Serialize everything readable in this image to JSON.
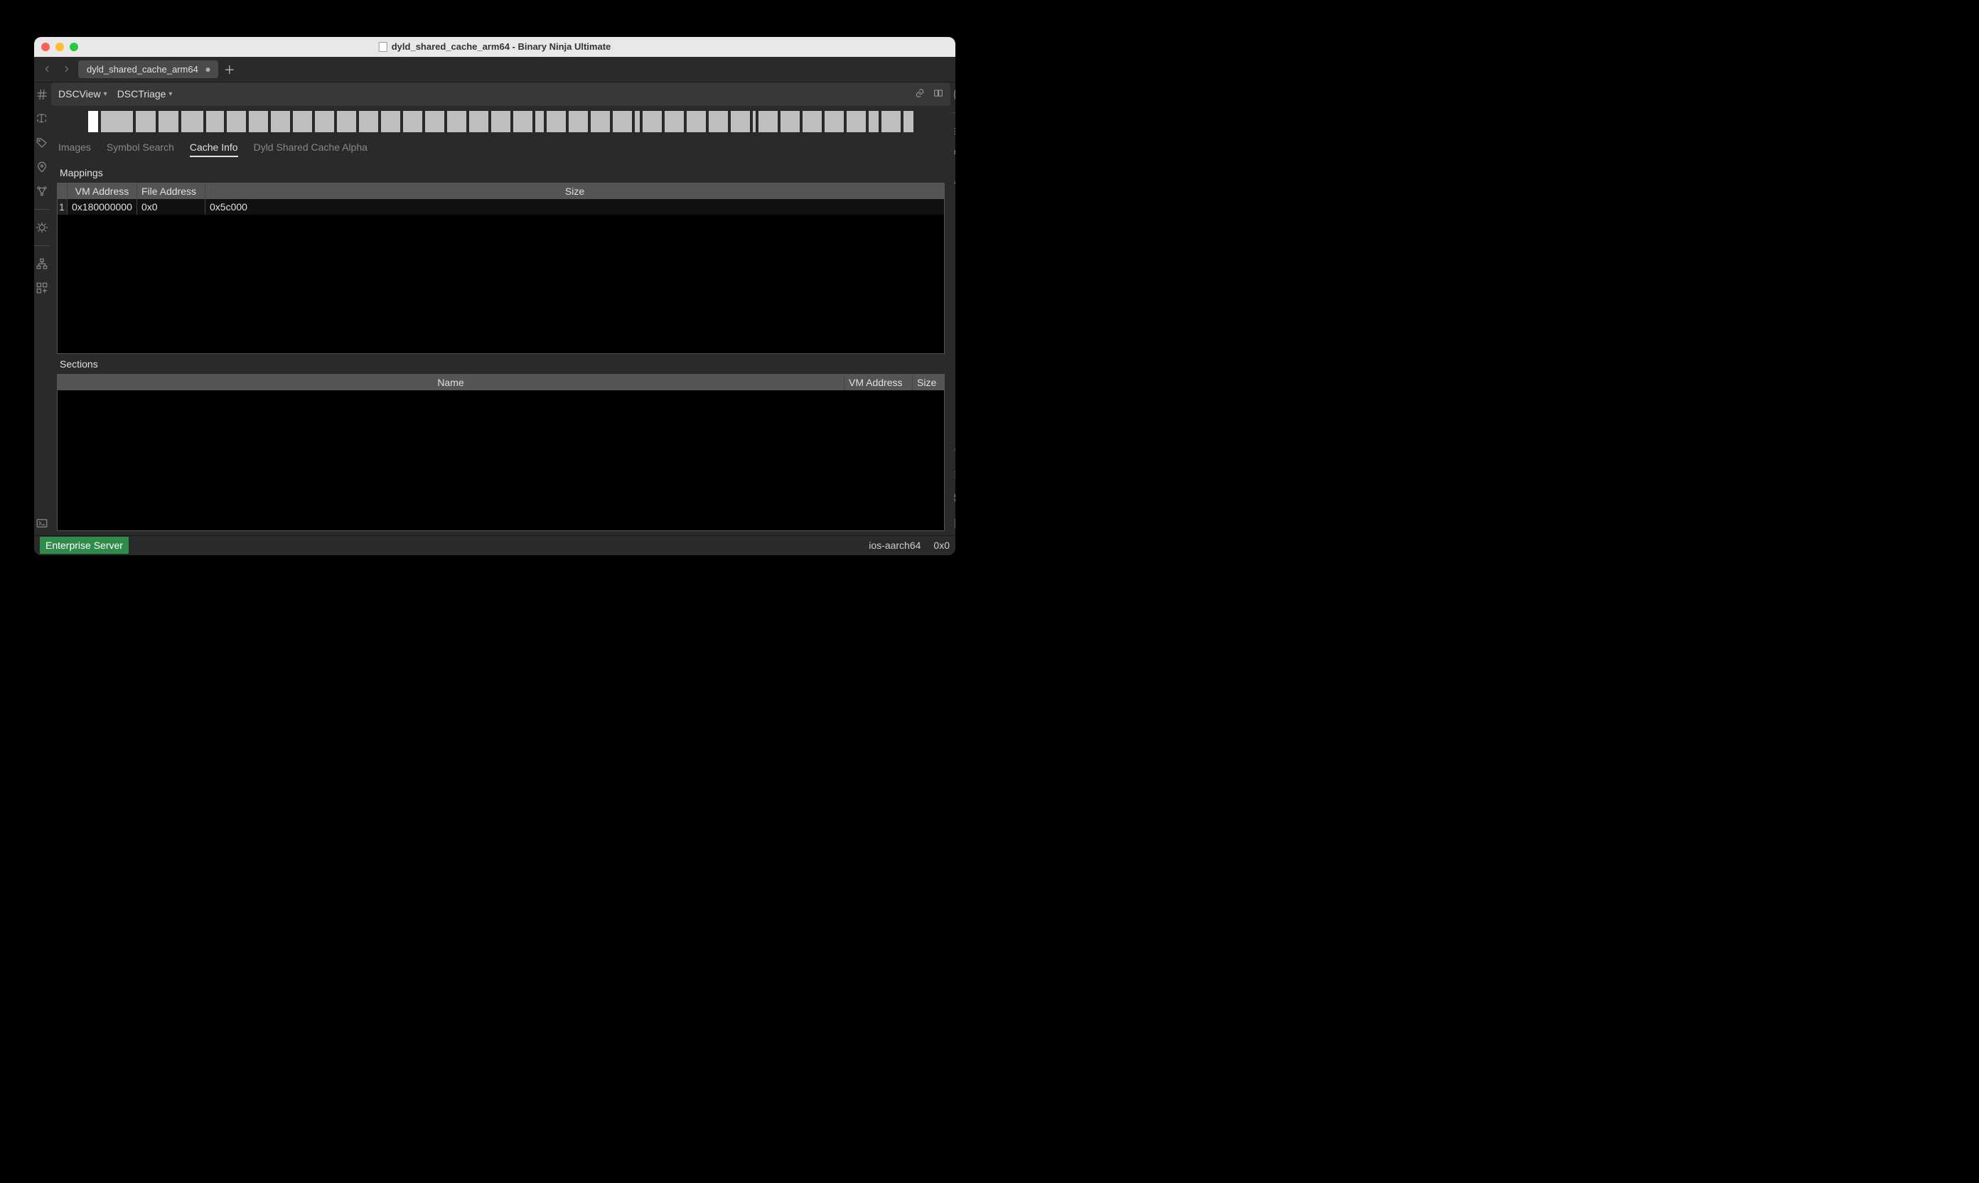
{
  "window": {
    "title": "dyld_shared_cache_arm64 - Binary Ninja Ultimate"
  },
  "tabs": {
    "items": [
      {
        "label": "dyld_shared_cache_arm64"
      }
    ]
  },
  "view_header": {
    "dropdowns": [
      {
        "label": "DSCView"
      },
      {
        "label": "DSCTriage"
      }
    ]
  },
  "section_tabs": [
    {
      "label": "Images",
      "active": false
    },
    {
      "label": "Symbol Search",
      "active": false
    },
    {
      "label": "Cache Info",
      "active": true
    },
    {
      "label": "Dyld Shared Cache Alpha",
      "active": false
    }
  ],
  "mappings": {
    "label": "Mappings",
    "columns": [
      "",
      "VM Address",
      "File Address",
      "Size"
    ],
    "rows": [
      {
        "idx": "1",
        "vm": "0x180000000",
        "fa": "0x0",
        "size": "0x5c000"
      }
    ]
  },
  "sections": {
    "label": "Sections",
    "columns": [
      "Name",
      "VM Address",
      "Size"
    ],
    "rows": []
  },
  "status": {
    "badge": "Enterprise Server",
    "arch": "ios-aarch64",
    "addr": "0x0"
  }
}
